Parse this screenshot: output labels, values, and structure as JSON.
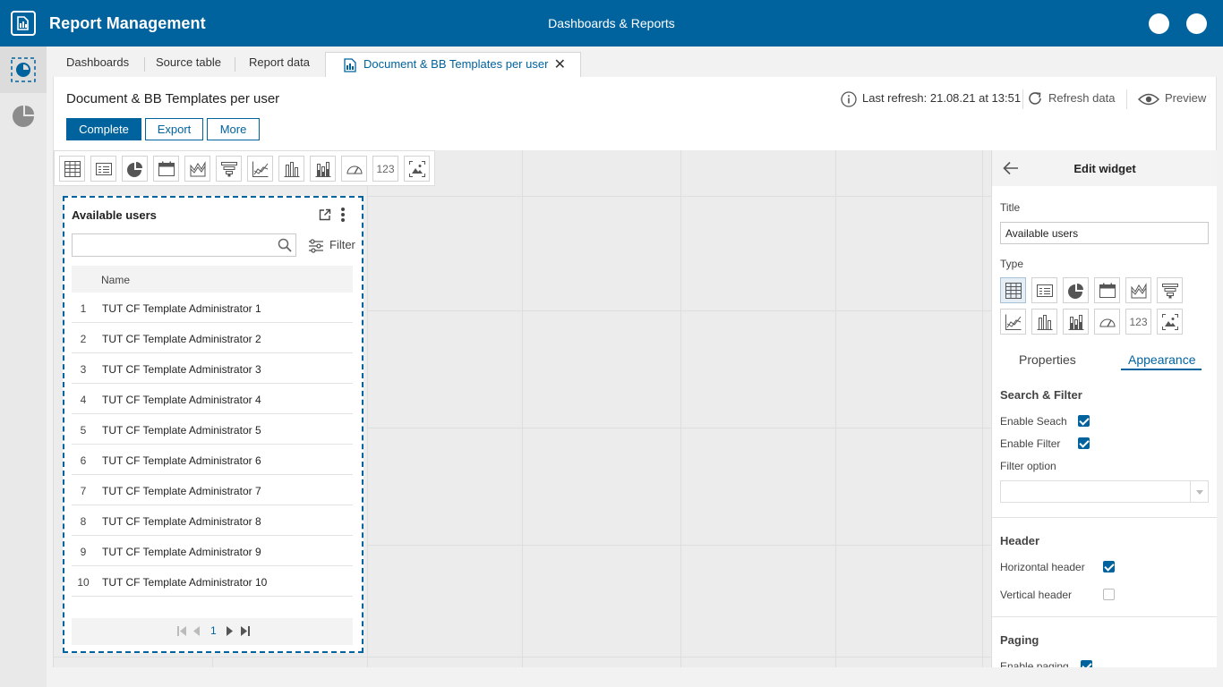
{
  "app": {
    "title": "Report Management",
    "center_title": "Dashboards & Reports",
    "brand_color": "#00639e"
  },
  "tabs": [
    {
      "label": "Dashboards"
    },
    {
      "label": "Source table"
    },
    {
      "label": "Report data"
    },
    {
      "label": "Document & BB Templates per user",
      "active": true
    }
  ],
  "page": {
    "title": "Document & BB Templates per user",
    "complete_label": "Complete",
    "export_label": "Export",
    "more_label": "More",
    "last_refresh": "Last refresh: 21.08.21 at 13:51",
    "refresh_label": "Refresh data",
    "preview_label": "Preview"
  },
  "widget": {
    "title": "Available users",
    "search_placeholder": "",
    "filter_label": "Filter",
    "column_name": "Name",
    "rows": [
      {
        "idx": "1",
        "name": "TUT CF Template Administrator 1"
      },
      {
        "idx": "2",
        "name": "TUT CF Template Administrator 2"
      },
      {
        "idx": "3",
        "name": "TUT CF Template Administrator 3"
      },
      {
        "idx": "4",
        "name": "TUT CF Template Administrator 4"
      },
      {
        "idx": "5",
        "name": "TUT CF Template Administrator 5"
      },
      {
        "idx": "6",
        "name": "TUT CF Template Administrator 6"
      },
      {
        "idx": "7",
        "name": "TUT CF Template Administrator 7"
      },
      {
        "idx": "8",
        "name": "TUT CF Template Administrator 8"
      },
      {
        "idx": "9",
        "name": "TUT CF Template Administrator 9"
      },
      {
        "idx": "10",
        "name": "TUT CF Template Administrator 10"
      }
    ],
    "page_number": "1"
  },
  "toolbox": {
    "number_label": "123"
  },
  "edit_widget": {
    "title": "Edit widget",
    "title_label": "Title",
    "title_value": "Available users",
    "type_label": "Type",
    "number_label": "123",
    "tab_properties": "Properties",
    "tab_appearance": "Appearance",
    "search_filter_section": "Search & Filter",
    "enable_search": "Enable Seach",
    "enable_filter": "Enable Filter",
    "filter_option": "Filter option",
    "header_section": "Header",
    "horizontal_header": "Horizontal header",
    "vertical_header": "Vertical header",
    "paging_section": "Paging",
    "enable_paging": "Enable paging"
  }
}
